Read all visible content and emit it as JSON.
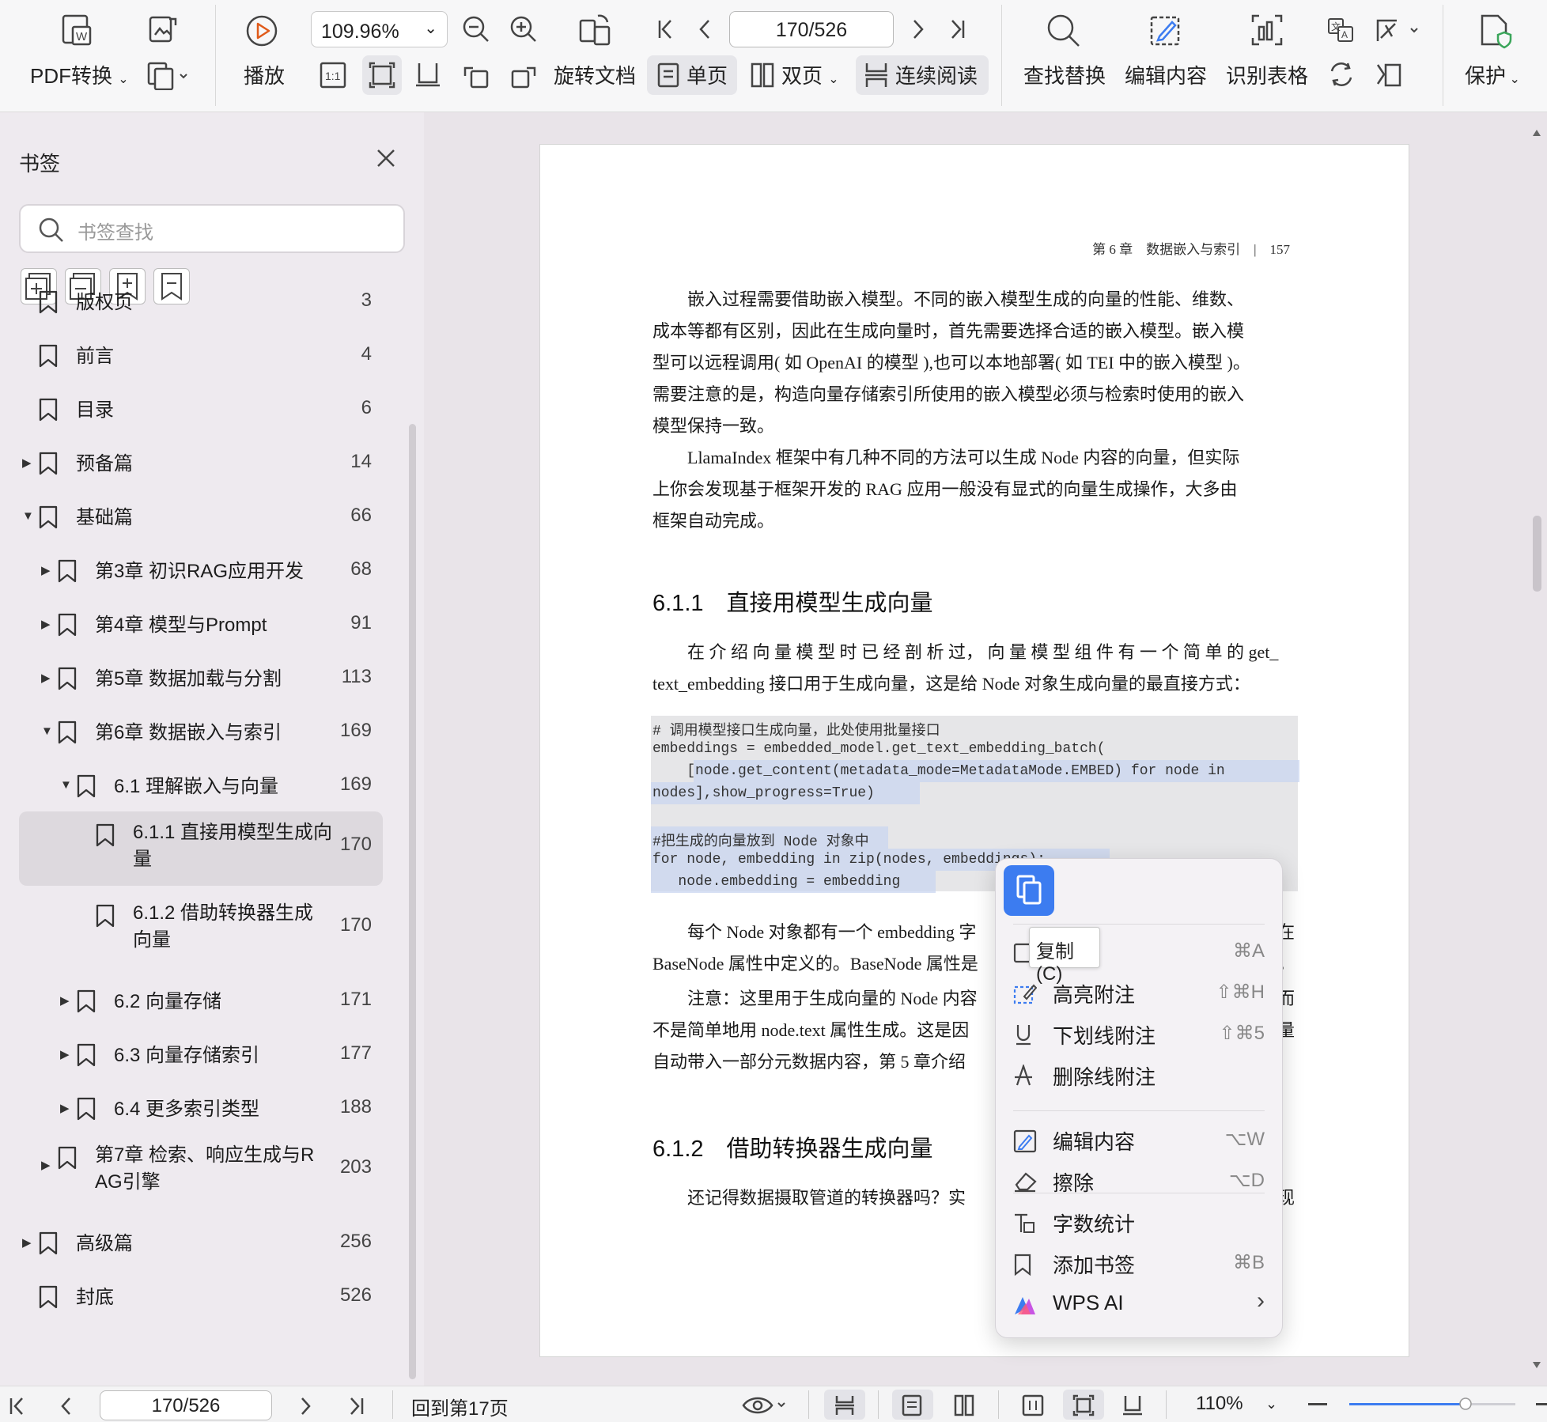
{
  "toolbar": {
    "pdf_convert": "PDF转换",
    "play": "播放",
    "zoom_value": "109.96%",
    "rotate_doc": "旋转文档",
    "page_indicator": "170/526",
    "single_page": "单页",
    "double_page": "双页",
    "continuous": "连续阅读",
    "find_replace": "查找替换",
    "edit_content": "编辑内容",
    "recognize_table": "识别表格",
    "protect": "保护",
    "fit_1to1": "1:1"
  },
  "sidebar": {
    "title": "书签",
    "search_placeholder": "书签查找",
    "items": [
      {
        "label": "版权页",
        "page": "3",
        "level": 0,
        "expander": "none"
      },
      {
        "label": "前言",
        "page": "4",
        "level": 0,
        "expander": "none"
      },
      {
        "label": "目录",
        "page": "6",
        "level": 0,
        "expander": "none"
      },
      {
        "label": "预备篇",
        "page": "14",
        "level": 0,
        "expander": "collapsed"
      },
      {
        "label": "基础篇",
        "page": "66",
        "level": 0,
        "expander": "expanded"
      },
      {
        "label": "第3章 初识RAG应用开发",
        "page": "68",
        "level": 1,
        "expander": "collapsed"
      },
      {
        "label": "第4章 模型与Prompt",
        "page": "91",
        "level": 1,
        "expander": "collapsed"
      },
      {
        "label": "第5章 数据加载与分割",
        "page": "113",
        "level": 1,
        "expander": "collapsed"
      },
      {
        "label": "第6章 数据嵌入与索引",
        "page": "169",
        "level": 1,
        "expander": "expanded"
      },
      {
        "label": "6.1 理解嵌入与向量",
        "page": "169",
        "level": 2,
        "expander": "expanded"
      },
      {
        "label": "6.1.1 直接用模型生成向",
        "label2": "量",
        "page": "170",
        "level": 3,
        "expander": "none",
        "selected": true
      },
      {
        "label": "6.1.2 借助转换器生成",
        "label2": "向量",
        "page": "170",
        "level": 3,
        "expander": "none"
      },
      {
        "label": "6.2 向量存储",
        "page": "171",
        "level": 2,
        "expander": "collapsed"
      },
      {
        "label": "6.3 向量存储索引",
        "page": "177",
        "level": 2,
        "expander": "collapsed"
      },
      {
        "label": "6.4 更多索引类型",
        "page": "188",
        "level": 2,
        "expander": "collapsed"
      },
      {
        "label": "第7章 检索、响应生成与R",
        "label2": "AG引擎",
        "page": "203",
        "level": 1,
        "expander": "collapsed"
      },
      {
        "label": "高级篇",
        "page": "256",
        "level": 0,
        "expander": "collapsed"
      },
      {
        "label": "封底",
        "page": "526",
        "level": 0,
        "expander": "none"
      }
    ]
  },
  "document": {
    "running_head": "第 6 章　数据嵌入与索引　|　157",
    "para1": [
      "　　嵌入过程需要借助嵌入模型。不同的嵌入模型生成的向量的性能、维数、",
      "成本等都有区别，因此在生成向量时，首先需要选择合适的嵌入模型。嵌入模",
      "型可以远程调用( 如 OpenAI 的模型 ),也可以本地部署( 如 TEI 中的嵌入模型 )。",
      "需要注意的是，构造向量存储索引所使用的嵌入模型必须与检索时使用的嵌入",
      "模型保持一致。"
    ],
    "para2": [
      "　　LlamaIndex 框架中有几种不同的方法可以生成 Node 内容的向量，但实际",
      "上你会发现基于框架开发的 RAG 应用一般没有显式的向量生成操作，大多由",
      "框架自动完成。"
    ],
    "section1": "6.1.1　直接用模型生成向量",
    "para3": [
      "　　在 介 绍 向 量 模 型 时 已 经 剖 析 过， 向 量 模 型 组 件 有 一 个 简 单 的 get_",
      "text_embedding 接口用于生成向量，这是给 Node 对象生成向量的最直接方式："
    ],
    "code": [
      "# 调用模型接口生成向量，此处使用批量接口",
      "embeddings = embedded_model.get_text_embedding_batch(",
      "    [node.get_content(metadata_mode=MetadataMode.EMBED) for node in",
      "nodes],show_progress=True)",
      "",
      "#把生成的向量放到 Node 对象中",
      "for node, embedding in zip(nodes, embeddings):",
      "   node.embedding = embedding"
    ],
    "para4": [
      "　　每个 Node 对象都有一个 embedding 字",
      "BaseNode 属性中定义的。BaseNode 属性是"
    ],
    "para4_right": [
      "在",
      "。"
    ],
    "para5": [
      "　　注意：这里用于生成向量的 Node 内容",
      "不是简单地用 node.text 属性生成。这是因",
      "自动带入一部分元数据内容，第 5 章介绍"
    ],
    "para5_right": [
      "而",
      "量"
    ],
    "section2": "6.1.2　借助转换器生成向量",
    "para6": [
      "　　还记得数据摄取管道的转换器吗？实"
    ],
    "para6_right": [
      "现"
    ]
  },
  "context_menu": {
    "items": [
      {
        "label": "复制(C)",
        "shortcut": "⌘A",
        "icon": "copy-icon"
      },
      {
        "label": "高亮附注",
        "shortcut": "⇧⌘H",
        "icon": "highlight-icon"
      },
      {
        "label": "下划线附注",
        "shortcut": "⇧⌘5",
        "icon": "underline-icon"
      },
      {
        "label": "删除线附注",
        "shortcut": "",
        "icon": "strikethrough-icon"
      },
      {
        "label": "编辑内容",
        "shortcut": "⌥W",
        "icon": "edit-icon"
      },
      {
        "label": "擦除",
        "shortcut": "⌥D",
        "icon": "eraser-icon"
      },
      {
        "label": "字数统计",
        "shortcut": "",
        "icon": "word-count-icon"
      },
      {
        "label": "添加书签",
        "shortcut": "⌘B",
        "icon": "bookmark-icon"
      },
      {
        "label": "WPS AI",
        "shortcut": "›",
        "icon": "wps-ai-icon"
      }
    ],
    "tooltip": "复制(C)"
  },
  "statusbar": {
    "page_indicator": "170/526",
    "back_to_page": "回到第17页",
    "zoom": "110%",
    "zoom_slider_fraction": 0.7
  },
  "colors": {
    "accent": "#3c7cf0",
    "selection": "#c9d5f0"
  }
}
